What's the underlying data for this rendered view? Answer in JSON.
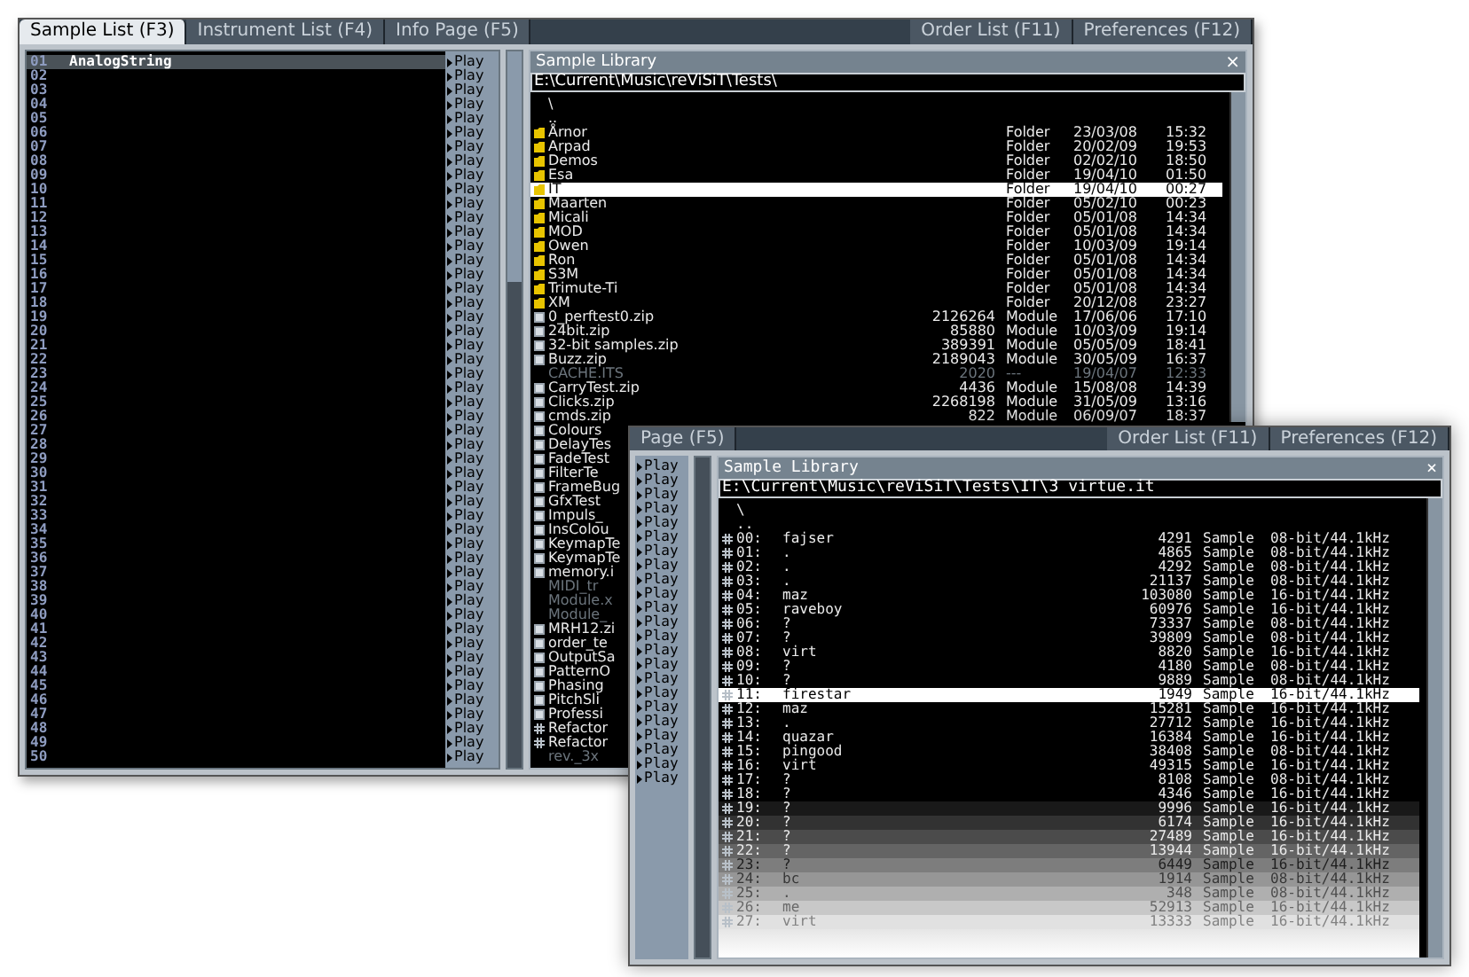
{
  "back_window": {
    "tabs_left": [
      {
        "label": "Sample List (F3)",
        "selected": true
      },
      {
        "label": "Instrument List (F4)",
        "selected": false
      },
      {
        "label": "Info Page (F5)",
        "selected": false
      }
    ],
    "tabs_right": [
      {
        "label": "Order List (F11)",
        "selected": false
      },
      {
        "label": "Preferences (F12)",
        "selected": false
      }
    ],
    "sample_list": [
      {
        "number": "01",
        "name": "AnalogString",
        "selected": true,
        "play": "Play"
      },
      {
        "number": "02",
        "selected": false,
        "play": "Play"
      },
      {
        "number": "03",
        "selected": false,
        "play": "Play"
      },
      {
        "number": "04",
        "selected": false,
        "play": "Play"
      },
      {
        "number": "05",
        "selected": false,
        "play": "Play"
      },
      {
        "number": "06",
        "selected": false,
        "play": "Play"
      },
      {
        "number": "07",
        "selected": false,
        "play": "Play"
      },
      {
        "number": "08",
        "selected": false,
        "play": "Play"
      },
      {
        "number": "09",
        "selected": false,
        "play": "Play"
      },
      {
        "number": "10",
        "selected": false,
        "play": "Play"
      },
      {
        "number": "11",
        "selected": false,
        "play": "Play"
      },
      {
        "number": "12",
        "selected": false,
        "play": "Play"
      },
      {
        "number": "13",
        "selected": false,
        "play": "Play"
      },
      {
        "number": "14",
        "selected": false,
        "play": "Play"
      },
      {
        "number": "15",
        "selected": false,
        "play": "Play"
      },
      {
        "number": "16",
        "selected": false,
        "play": "Play"
      },
      {
        "number": "17",
        "selected": false,
        "play": "Play"
      },
      {
        "number": "18",
        "selected": false,
        "play": "Play"
      },
      {
        "number": "19",
        "selected": false,
        "play": "Play"
      },
      {
        "number": "20",
        "selected": false,
        "play": "Play"
      },
      {
        "number": "21",
        "selected": false,
        "play": "Play"
      },
      {
        "number": "22",
        "selected": false,
        "play": "Play"
      },
      {
        "number": "23",
        "selected": false,
        "play": "Play"
      },
      {
        "number": "24",
        "selected": false,
        "play": "Play"
      },
      {
        "number": "25",
        "selected": false,
        "play": "Play"
      },
      {
        "number": "26",
        "selected": false,
        "play": "Play"
      },
      {
        "number": "27",
        "selected": false,
        "play": "Play"
      },
      {
        "number": "28",
        "selected": false,
        "play": "Play"
      },
      {
        "number": "29",
        "selected": false,
        "play": "Play"
      },
      {
        "number": "30",
        "selected": false,
        "play": "Play"
      },
      {
        "number": "31",
        "selected": false,
        "play": "Play"
      },
      {
        "number": "32",
        "selected": false,
        "play": "Play"
      },
      {
        "number": "33",
        "selected": false,
        "play": "Play"
      },
      {
        "number": "34",
        "selected": false,
        "play": "Play"
      },
      {
        "number": "35",
        "selected": false,
        "play": "Play"
      },
      {
        "number": "36",
        "selected": false,
        "play": "Play"
      },
      {
        "number": "37",
        "selected": false,
        "play": "Play"
      },
      {
        "number": "38",
        "selected": false,
        "play": "Play"
      },
      {
        "number": "39",
        "selected": false,
        "play": "Play"
      },
      {
        "number": "40",
        "selected": false,
        "play": "Play"
      },
      {
        "number": "41",
        "selected": false,
        "play": "Play"
      },
      {
        "number": "42",
        "selected": false,
        "play": "Play"
      },
      {
        "number": "43",
        "selected": false,
        "play": "Play"
      },
      {
        "number": "44",
        "selected": false,
        "play": "Play"
      },
      {
        "number": "45",
        "selected": false,
        "play": "Play"
      },
      {
        "number": "46",
        "selected": false,
        "play": "Play"
      },
      {
        "number": "47",
        "selected": false,
        "play": "Play"
      },
      {
        "number": "48",
        "selected": false,
        "play": "Play"
      },
      {
        "number": "49",
        "selected": false,
        "play": "Play"
      },
      {
        "number": "50",
        "selected": false,
        "play": "Play"
      }
    ],
    "library": {
      "title": "Sample Library",
      "close": "×",
      "path": "E:\\Current\\Music\\reViSiT\\Tests\\",
      "files": [
        {
          "kind": "up",
          "name": "\\",
          "selected": false
        },
        {
          "kind": "up",
          "name": "..",
          "selected": false
        },
        {
          "kind": "folder",
          "name": "Årnor",
          "type": "Folder",
          "date": "23/03/08",
          "time": "15:32",
          "selected": false
        },
        {
          "kind": "folder",
          "name": "Arpad",
          "type": "Folder",
          "date": "20/02/09",
          "time": "19:53",
          "selected": false
        },
        {
          "kind": "folder",
          "name": "Demos",
          "type": "Folder",
          "date": "02/02/10",
          "time": "18:50",
          "selected": false
        },
        {
          "kind": "folder",
          "name": "Esa",
          "type": "Folder",
          "date": "19/04/10",
          "time": "01:50",
          "selected": false
        },
        {
          "kind": "folder",
          "name": "IT",
          "type": "Folder",
          "date": "19/04/10",
          "time": "00:27",
          "selected": true
        },
        {
          "kind": "folder",
          "name": "Maarten",
          "type": "Folder",
          "date": "05/02/10",
          "time": "00:23",
          "selected": false
        },
        {
          "kind": "folder",
          "name": "Micali",
          "type": "Folder",
          "date": "05/01/08",
          "time": "14:34",
          "selected": false
        },
        {
          "kind": "folder",
          "name": "MOD",
          "type": "Folder",
          "date": "05/01/08",
          "time": "14:34",
          "selected": false
        },
        {
          "kind": "folder",
          "name": "Owen",
          "type": "Folder",
          "date": "10/03/09",
          "time": "19:14",
          "selected": false
        },
        {
          "kind": "folder",
          "name": "Ron",
          "type": "Folder",
          "date": "05/01/08",
          "time": "14:34",
          "selected": false
        },
        {
          "kind": "folder",
          "name": "S3M",
          "type": "Folder",
          "date": "05/01/08",
          "time": "14:34",
          "selected": false
        },
        {
          "kind": "folder",
          "name": "Trimute-Ti",
          "type": "Folder",
          "date": "05/01/08",
          "time": "14:34",
          "selected": false
        },
        {
          "kind": "folder",
          "name": "XM",
          "type": "Folder",
          "date": "20/12/08",
          "time": "23:27",
          "selected": false
        },
        {
          "kind": "archive",
          "name": "0_perftest0.zip",
          "size": "2126264",
          "type": "Module",
          "date": "17/06/06",
          "time": "17:10",
          "selected": false
        },
        {
          "kind": "archive",
          "name": "24bit.zip",
          "size": "85880",
          "type": "Module",
          "date": "10/03/09",
          "time": "19:14",
          "selected": false
        },
        {
          "kind": "archive",
          "name": "32-bit samples.zip",
          "size": "389391",
          "type": "Module",
          "date": "05/05/09",
          "time": "18:41",
          "selected": false
        },
        {
          "kind": "archive",
          "name": "Buzz.zip",
          "size": "2189043",
          "type": "Module",
          "date": "30/05/09",
          "time": "16:37",
          "selected": false
        },
        {
          "kind": "other",
          "name": "CACHE.ITS",
          "size": "2020",
          "type": "---",
          "date": "19/04/07",
          "time": "12:33",
          "selected": false
        },
        {
          "kind": "archive",
          "name": "CarryTest.zip",
          "size": "4436",
          "type": "Module",
          "date": "15/08/08",
          "time": "14:39",
          "selected": false
        },
        {
          "kind": "archive",
          "name": "Clicks.zip",
          "size": "2268198",
          "type": "Module",
          "date": "31/05/09",
          "time": "13:16",
          "selected": false
        },
        {
          "kind": "archive",
          "name": "cmds.zip",
          "size": "822",
          "type": "Module",
          "date": "06/09/07",
          "time": "18:37",
          "selected": false
        },
        {
          "kind": "archive",
          "name": "Colours",
          "selected": false
        },
        {
          "kind": "archive",
          "name": "DelayTes",
          "selected": false
        },
        {
          "kind": "archive",
          "name": "FadeTest",
          "selected": false
        },
        {
          "kind": "archive",
          "name": "FilterTe",
          "selected": false
        },
        {
          "kind": "archive",
          "name": "FrameBug",
          "selected": false
        },
        {
          "kind": "archive",
          "name": "GfxTest",
          "selected": false
        },
        {
          "kind": "archive",
          "name": "Impuls_",
          "selected": false
        },
        {
          "kind": "archive",
          "name": "InsColou",
          "selected": false
        },
        {
          "kind": "archive",
          "name": "KeymapTe",
          "selected": false
        },
        {
          "kind": "archive",
          "name": "KeymapTe",
          "selected": false
        },
        {
          "kind": "archive",
          "name": "memory.i",
          "selected": false
        },
        {
          "kind": "other",
          "name": "MIDI_tr",
          "selected": false
        },
        {
          "kind": "other",
          "name": "Module.x",
          "selected": false
        },
        {
          "kind": "other",
          "name": "Module_",
          "selected": false
        },
        {
          "kind": "archive",
          "name": "MRH12.zi",
          "selected": false
        },
        {
          "kind": "archive",
          "name": "order_te",
          "selected": false
        },
        {
          "kind": "archive",
          "name": "OutputSa",
          "selected": false
        },
        {
          "kind": "archive",
          "name": "PatternO",
          "selected": false
        },
        {
          "kind": "archive",
          "name": "Phasing",
          "selected": false
        },
        {
          "kind": "archive",
          "name": "PitchSli",
          "selected": false
        },
        {
          "kind": "archive",
          "name": "Professi",
          "selected": false
        },
        {
          "kind": "sample",
          "name": "Refactor",
          "selected": false
        },
        {
          "kind": "sample",
          "name": "Refactor",
          "selected": false
        },
        {
          "kind": "other",
          "name": "rev._3x",
          "selected": false
        }
      ]
    }
  },
  "front_window": {
    "tabs_left": [
      {
        "label": "Page (F5)",
        "selected": false
      }
    ],
    "tabs_right": [
      {
        "label": "Order List (F11)",
        "selected": false
      },
      {
        "label": "Preferences (F12)",
        "selected": false
      }
    ],
    "play_buttons": [
      "Play",
      "Play",
      "Play",
      "Play",
      "Play",
      "Play",
      "Play",
      "Play",
      "Play",
      "Play",
      "Play",
      "Play",
      "Play",
      "Play",
      "Play",
      "Play",
      "Play",
      "Play",
      "Play",
      "Play",
      "Play",
      "Play",
      "Play"
    ],
    "library": {
      "title": "Sample Library",
      "close": "×",
      "path": "E:\\Current\\Music\\reViSiT\\Tests\\IT\\3 virtue.it",
      "files": [
        {
          "kind": "up",
          "name": "\\",
          "selected": false
        },
        {
          "kind": "up",
          "name": "..",
          "selected": false
        },
        {
          "kind": "sample",
          "index": "00:",
          "name": "fajser",
          "size": "4291",
          "type": "Sample",
          "format": "08-bit/44.1kHz",
          "selected": false
        },
        {
          "kind": "sample",
          "index": "01:",
          "name": ".",
          "size": "4865",
          "type": "Sample",
          "format": "08-bit/44.1kHz",
          "selected": false
        },
        {
          "kind": "sample",
          "index": "02:",
          "name": ".",
          "size": "4292",
          "type": "Sample",
          "format": "08-bit/44.1kHz",
          "selected": false
        },
        {
          "kind": "sample",
          "index": "03:",
          "name": ".",
          "size": "21137",
          "type": "Sample",
          "format": "08-bit/44.1kHz",
          "selected": false
        },
        {
          "kind": "sample",
          "index": "04:",
          "name": "maz",
          "size": "103080",
          "type": "Sample",
          "format": "16-bit/44.1kHz",
          "selected": false
        },
        {
          "kind": "sample",
          "index": "05:",
          "name": "raveboy",
          "size": "60976",
          "type": "Sample",
          "format": "16-bit/44.1kHz",
          "selected": false
        },
        {
          "kind": "sample",
          "index": "06:",
          "name": "?",
          "size": "73337",
          "type": "Sample",
          "format": "08-bit/44.1kHz",
          "selected": false
        },
        {
          "kind": "sample",
          "index": "07:",
          "name": "?",
          "size": "39809",
          "type": "Sample",
          "format": "08-bit/44.1kHz",
          "selected": false
        },
        {
          "kind": "sample",
          "index": "08:",
          "name": "virt",
          "size": "8820",
          "type": "Sample",
          "format": "16-bit/44.1kHz",
          "selected": false
        },
        {
          "kind": "sample",
          "index": "09:",
          "name": "?",
          "size": "4180",
          "type": "Sample",
          "format": "08-bit/44.1kHz",
          "selected": false
        },
        {
          "kind": "sample",
          "index": "10:",
          "name": "?",
          "size": "9889",
          "type": "Sample",
          "format": "08-bit/44.1kHz",
          "selected": false
        },
        {
          "kind": "sample",
          "index": "11:",
          "name": "firestar",
          "size": "1949",
          "type": "Sample",
          "format": "16-bit/44.1kHz",
          "selected": true
        },
        {
          "kind": "sample",
          "index": "12:",
          "name": "maz",
          "size": "15281",
          "type": "Sample",
          "format": "16-bit/44.1kHz",
          "selected": false
        },
        {
          "kind": "sample",
          "index": "13:",
          "name": ".",
          "size": "27712",
          "type": "Sample",
          "format": "16-bit/44.1kHz",
          "selected": false
        },
        {
          "kind": "sample",
          "index": "14:",
          "name": "quazar",
          "size": "16384",
          "type": "Sample",
          "format": "16-bit/44.1kHz",
          "selected": false
        },
        {
          "kind": "sample",
          "index": "15:",
          "name": "pingood",
          "size": "38408",
          "type": "Sample",
          "format": "08-bit/44.1kHz",
          "selected": false
        },
        {
          "kind": "sample",
          "index": "16:",
          "name": "virt",
          "size": "49315",
          "type": "Sample",
          "format": "16-bit/44.1kHz",
          "selected": false
        },
        {
          "kind": "sample",
          "index": "17:",
          "name": "?",
          "size": "8108",
          "type": "Sample",
          "format": "08-bit/44.1kHz",
          "selected": false
        },
        {
          "kind": "sample",
          "index": "18:",
          "name": "?",
          "size": "4346",
          "type": "Sample",
          "format": "16-bit/44.1kHz",
          "selected": false
        },
        {
          "kind": "sample",
          "index": "19:",
          "name": "?",
          "size": "9996",
          "type": "Sample",
          "format": "16-bit/44.1kHz",
          "selected": false
        },
        {
          "kind": "sample",
          "index": "20:",
          "name": "?",
          "size": "6174",
          "type": "Sample",
          "format": "16-bit/44.1kHz",
          "selected": false
        },
        {
          "kind": "sample",
          "index": "21:",
          "name": "?",
          "size": "27489",
          "type": "Sample",
          "format": "16-bit/44.1kHz",
          "selected": false
        },
        {
          "kind": "sample",
          "index": "22:",
          "name": "?",
          "size": "13944",
          "type": "Sample",
          "format": "16-bit/44.1kHz",
          "selected": false
        },
        {
          "kind": "sample",
          "index": "23:",
          "name": "?",
          "size": "6449",
          "type": "Sample",
          "format": "16-bit/44.1kHz",
          "selected": false
        },
        {
          "kind": "sample",
          "index": "24:",
          "name": "bc",
          "size": "1914",
          "type": "Sample",
          "format": "08-bit/44.1kHz",
          "selected": false
        },
        {
          "kind": "sample",
          "index": "25:",
          "name": ".",
          "size": "348",
          "type": "Sample",
          "format": "08-bit/44.1kHz",
          "selected": false
        },
        {
          "kind": "sample",
          "index": "26:",
          "name": "me",
          "size": "52913",
          "type": "Sample",
          "format": "16-bit/44.1kHz",
          "selected": false
        },
        {
          "kind": "sample",
          "index": "27:",
          "name": "virt",
          "size": "13333",
          "type": "Sample",
          "format": "16-bit/44.1kHz",
          "selected": false
        }
      ]
    }
  }
}
